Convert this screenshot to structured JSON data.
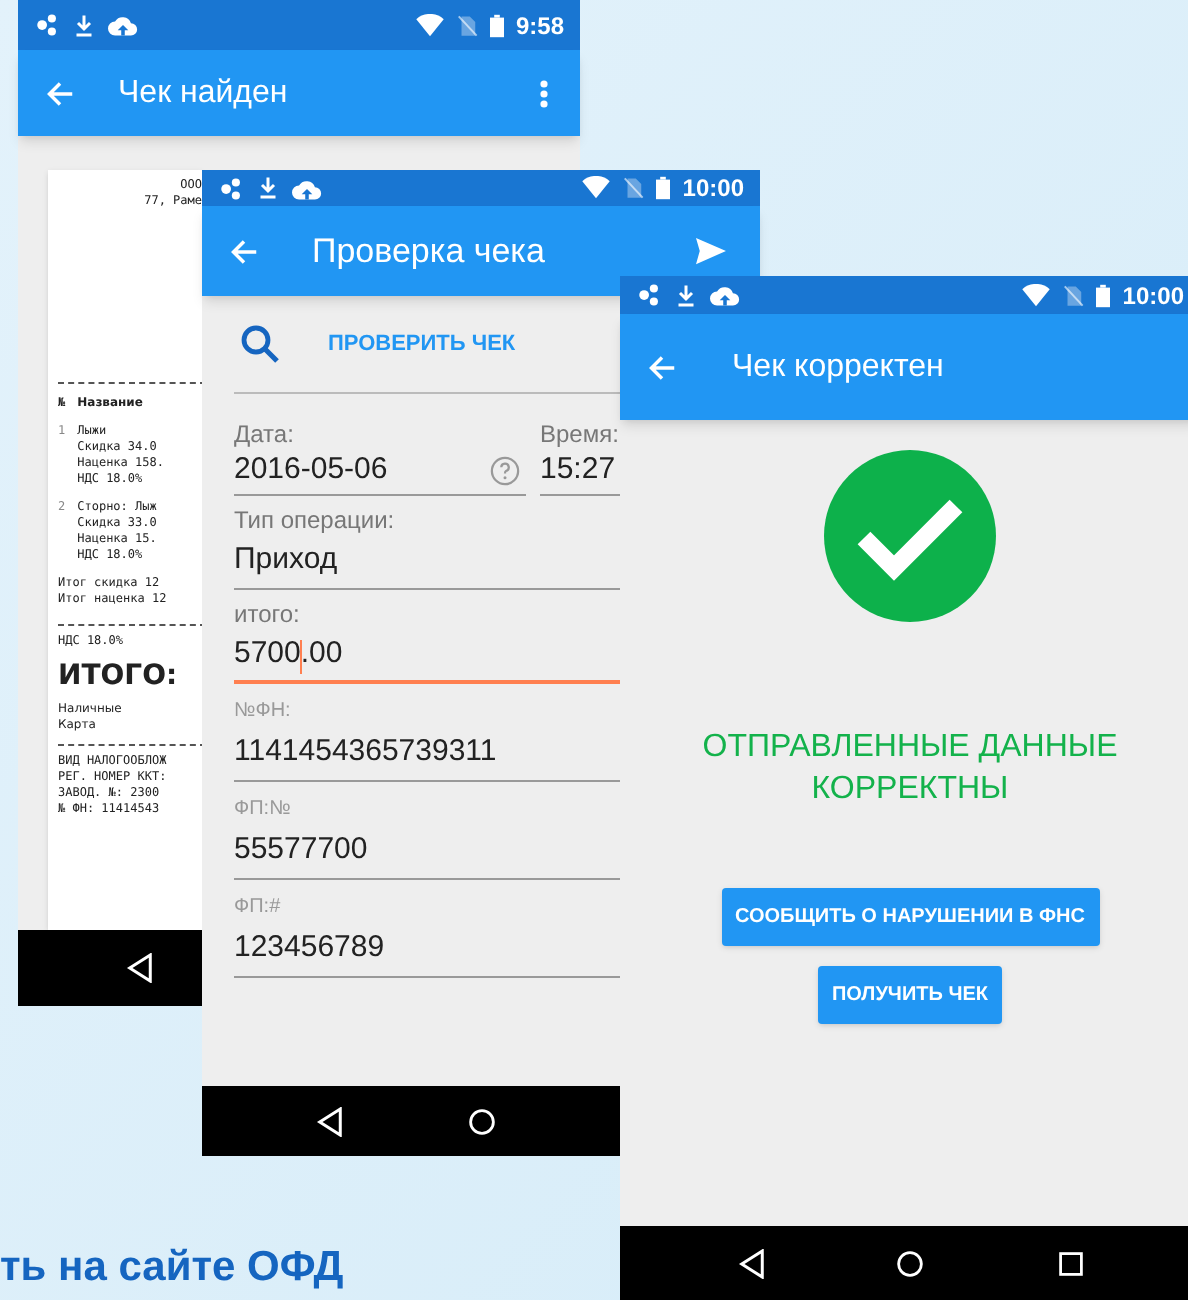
{
  "screens": [
    {
      "status_time": "9:58",
      "title": "Чек найден",
      "receipt": {
        "header": [
          "ООО",
          "77, Раме"
        ],
        "column_no": "№",
        "column_name": "Название",
        "items": [
          {
            "number": "1",
            "lines": [
              "Лыжи",
              "Скидка 34.0",
              "Наценка 158.",
              "НДС 18.0%"
            ]
          },
          {
            "number": "2",
            "lines": [
              "Сторно: Лыж",
              "Скидка 33.0",
              "Наценка 15.",
              "НДС 18.0%"
            ]
          }
        ],
        "totals": [
          "Итог скидка 12",
          "Итог наценка 12"
        ],
        "vat": "НДС 18.0%",
        "total_label": "ИТОГО:",
        "payments": [
          "Наличные",
          "Карта"
        ],
        "footer": [
          "ВИД НАЛОГООБЛОЖ",
          "РЕГ. НОМЕР ККТ:",
          "ЗАВОД. №: 2300",
          "№ ФН: 11414543"
        ]
      }
    },
    {
      "status_time": "10:00",
      "title": "Проверка чека",
      "action": "ПРОВЕРИТЬ ЧЕК",
      "date": {
        "label": "Дата:",
        "value": "2016-05-06"
      },
      "time": {
        "label": "Время:",
        "value": "15:27"
      },
      "fields": [
        {
          "label": "Тип операции:",
          "value": "Приход",
          "focused": false
        },
        {
          "label": "итого:",
          "value": "5700.00",
          "focused": true
        },
        {
          "label": "№ФН:",
          "value": "1141454365739311",
          "focused": false
        },
        {
          "label": "ФП:№",
          "value": "55577700",
          "focused": false
        },
        {
          "label": "ФП:#",
          "value": "123456789",
          "focused": false
        }
      ]
    },
    {
      "status_time": "10:00",
      "title": "Чек корректен",
      "result": "ОТПРАВЛЕННЫЕ ДАННЫЕ КОРРЕКТНЫ",
      "buttons": [
        "СООБЩИТЬ О НАРУШЕНИИ В ФНС",
        "ПОЛУЧИТЬ ЧЕК"
      ]
    }
  ],
  "caption": "ть на сайте ОФД"
}
